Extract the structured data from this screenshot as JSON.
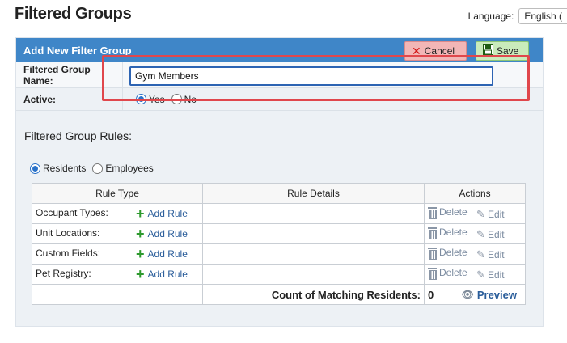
{
  "page": {
    "title": "Filtered Groups"
  },
  "language": {
    "label": "Language:",
    "selected": "English ("
  },
  "panel": {
    "header": "Add New Filter Group",
    "cancel_label": "Cancel",
    "save_label": "Save"
  },
  "form": {
    "name_label": "Filtered Group Name:",
    "name_value": "Gym Members",
    "active_label": "Active:",
    "active_options": [
      {
        "label": "Yes",
        "selected": true
      },
      {
        "label": "No",
        "selected": false
      }
    ]
  },
  "rules": {
    "title": "Filtered Group Rules:",
    "scope_options": [
      {
        "label": "Residents",
        "selected": true
      },
      {
        "label": "Employees",
        "selected": false
      }
    ],
    "columns": [
      "Rule Type",
      "Rule Details",
      "Actions"
    ],
    "rows": [
      {
        "type": "Occupant Types:",
        "add_label": "Add Rule",
        "delete_label": "Delete",
        "edit_label": "Edit"
      },
      {
        "type": "Unit Locations:",
        "add_label": "Add Rule",
        "delete_label": "Delete",
        "edit_label": "Edit"
      },
      {
        "type": "Custom Fields:",
        "add_label": "Add Rule",
        "delete_label": "Delete",
        "edit_label": "Edit"
      },
      {
        "type": "Pet Registry:",
        "add_label": "Add Rule",
        "delete_label": "Delete",
        "edit_label": "Edit"
      }
    ],
    "count_label": "Count of Matching Residents:",
    "count_value": "0",
    "preview_label": "Preview"
  },
  "icons": {
    "cancel": "close-x-icon",
    "save": "floppy-disk-icon",
    "add": "plus-icon",
    "delete": "trash-icon",
    "edit": "pencil-icon",
    "preview": "eye-icon"
  },
  "colors": {
    "header_bg": "#3f86c8",
    "cancel_bg": "#f2b6b6",
    "save_bg": "#c9ebbb",
    "focus_border": "#2d64b3",
    "highlight": "#e0474c"
  }
}
